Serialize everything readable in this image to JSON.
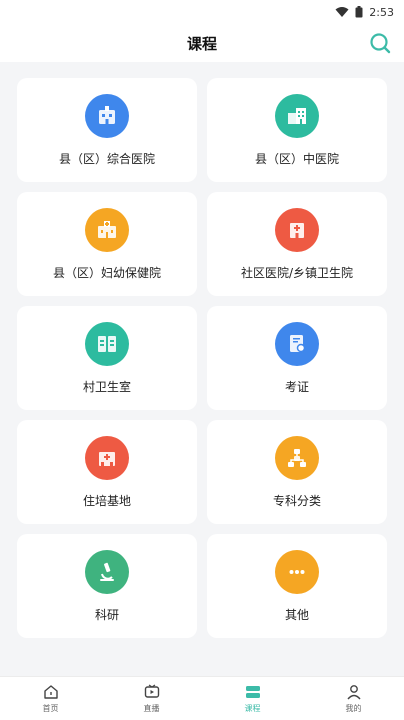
{
  "status_bar": {
    "time": "2:53"
  },
  "header": {
    "title": "课程"
  },
  "categories": [
    {
      "label": "县（区）综合医院",
      "icon": "hospital-building-icon",
      "color": "#3f87ec"
    },
    {
      "label": "县（区）中医院",
      "icon": "hospital-building-icon",
      "color": "#2dbb9f"
    },
    {
      "label": "县（区）妇幼保健院",
      "icon": "hospital-building-icon",
      "color": "#f5a623"
    },
    {
      "label": "社区医院/乡镇卫生院",
      "icon": "hospital-building-icon",
      "color": "#ee5a43"
    },
    {
      "label": "村卫生室",
      "icon": "clinic-icon",
      "color": "#2dbb9f"
    },
    {
      "label": "考证",
      "icon": "certificate-icon",
      "color": "#3f87ec"
    },
    {
      "label": "住培基地",
      "icon": "hospital-building-icon",
      "color": "#ee5a43"
    },
    {
      "label": "专科分类",
      "icon": "hierarchy-icon",
      "color": "#f5a623"
    },
    {
      "label": "科研",
      "icon": "microscope-icon",
      "color": "#3fb37f"
    },
    {
      "label": "其他",
      "icon": "more-dots-icon",
      "color": "#f5a623"
    }
  ],
  "tabbar": {
    "tabs": [
      {
        "label": "首页",
        "icon": "home-icon"
      },
      {
        "label": "直播",
        "icon": "live-tv-icon"
      },
      {
        "label": "课程",
        "icon": "course-icon",
        "active": true
      },
      {
        "label": "我的",
        "icon": "user-icon"
      }
    ]
  }
}
